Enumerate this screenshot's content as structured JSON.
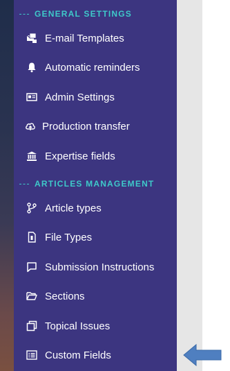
{
  "sidebar": {
    "sections": [
      {
        "title": "GENERAL SETTINGS",
        "items": [
          {
            "label": "E-mail Templates",
            "icon": "email-templates-icon"
          },
          {
            "label": "Automatic reminders",
            "icon": "bell-icon"
          },
          {
            "label": "Admin Settings",
            "icon": "admin-card-icon"
          },
          {
            "label": "Production transfer",
            "icon": "cloud-upload-icon"
          },
          {
            "label": "Expertise fields",
            "icon": "institution-icon"
          }
        ]
      },
      {
        "title": "ARTICLES MANAGEMENT",
        "items": [
          {
            "label": "Article types",
            "icon": "branch-icon"
          },
          {
            "label": "File Types",
            "icon": "file-icon"
          },
          {
            "label": "Submission Instructions",
            "icon": "chat-icon"
          },
          {
            "label": "Sections",
            "icon": "folder-open-icon"
          },
          {
            "label": "Topical Issues",
            "icon": "copy-icon"
          },
          {
            "label": "Custom Fields",
            "icon": "list-box-icon"
          }
        ]
      }
    ]
  },
  "colors": {
    "sidebar_bg": "#3c3580",
    "section_header": "#3ec9c9",
    "item_text": "#ffffff",
    "arrow": "#4f7fc0"
  },
  "arrow": {
    "icon": "left-arrow-indicator-icon"
  }
}
